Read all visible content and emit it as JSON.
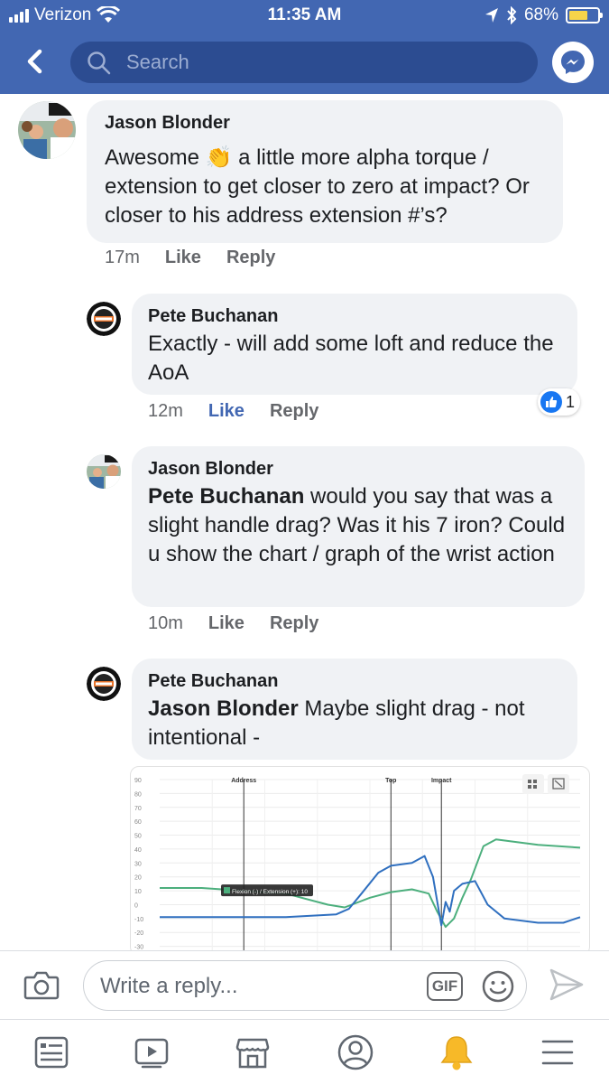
{
  "status_bar": {
    "carrier": "Verizon",
    "time": "11:35 AM",
    "battery": "68%",
    "battery_level": 0.68
  },
  "header": {
    "search_placeholder": "Search"
  },
  "comments": [
    {
      "author": "Jason Blonder",
      "text_before_emoji": "Awesome ",
      "emoji": "👏",
      "text_after_emoji": " a little more alpha torque / extension to get closer to zero at impact? Or closer to his address extension #’s?",
      "time": "17m",
      "like_label": "Like",
      "reply_label": "Reply"
    },
    {
      "author": "Pete Buchanan",
      "text": "Exactly - will add some loft and reduce the AoA",
      "time": "12m",
      "like_label": "Like",
      "reply_label": "Reply",
      "reaction_count": "1"
    },
    {
      "author": "Jason Blonder",
      "mention": "Pete Buchanan",
      "text": " would you say that was a slight handle drag? Was it his 7 iron? Could u show the chart / graph of the wrist action",
      "time": "10m",
      "like_label": "Like",
      "reply_label": "Reply"
    },
    {
      "author": "Pete Buchanan",
      "mention": "Jason Blonder",
      "text": " Maybe slight drag - not intentional -"
    }
  ],
  "chart_data": {
    "type": "line",
    "ylim": [
      -40,
      90
    ],
    "y_ticks": [
      "90",
      "80",
      "70",
      "60",
      "50",
      "40",
      "30",
      "20",
      "10",
      "0",
      "-10",
      "-20",
      "-30",
      "-40"
    ],
    "markers": [
      {
        "label": "Address",
        "x": 0.2
      },
      {
        "label": "Top",
        "x": 0.55
      },
      {
        "label": "Impact",
        "x": 0.67
      }
    ],
    "tooltip": "Flexion (-) / Extension (+): 10",
    "series": [
      {
        "color": "#4caf7d",
        "x": [
          0,
          0.05,
          0.1,
          0.2,
          0.3,
          0.4,
          0.44,
          0.5,
          0.55,
          0.6,
          0.64,
          0.66,
          0.68,
          0.7,
          0.72,
          0.74,
          0.77,
          0.8,
          0.85,
          0.9,
          1.0
        ],
        "values": [
          12,
          12,
          12,
          10,
          8,
          0,
          -2,
          5,
          9,
          11,
          8,
          -5,
          -16,
          -10,
          5,
          18,
          42,
          47,
          45,
          43,
          41
        ]
      },
      {
        "color": "#2f6fbf",
        "x": [
          0,
          0.1,
          0.2,
          0.3,
          0.42,
          0.45,
          0.48,
          0.52,
          0.55,
          0.6,
          0.63,
          0.65,
          0.67,
          0.68,
          0.69,
          0.7,
          0.72,
          0.75,
          0.78,
          0.82,
          0.9,
          0.96,
          1.0
        ],
        "values": [
          -9,
          -9,
          -9,
          -9,
          -7,
          -3,
          8,
          23,
          28,
          30,
          35,
          20,
          -15,
          2,
          -5,
          10,
          15,
          17,
          0,
          -10,
          -13,
          -13,
          -9
        ]
      }
    ]
  },
  "reply_bar": {
    "placeholder": "Write a reply...",
    "gif_label": "GIF"
  }
}
